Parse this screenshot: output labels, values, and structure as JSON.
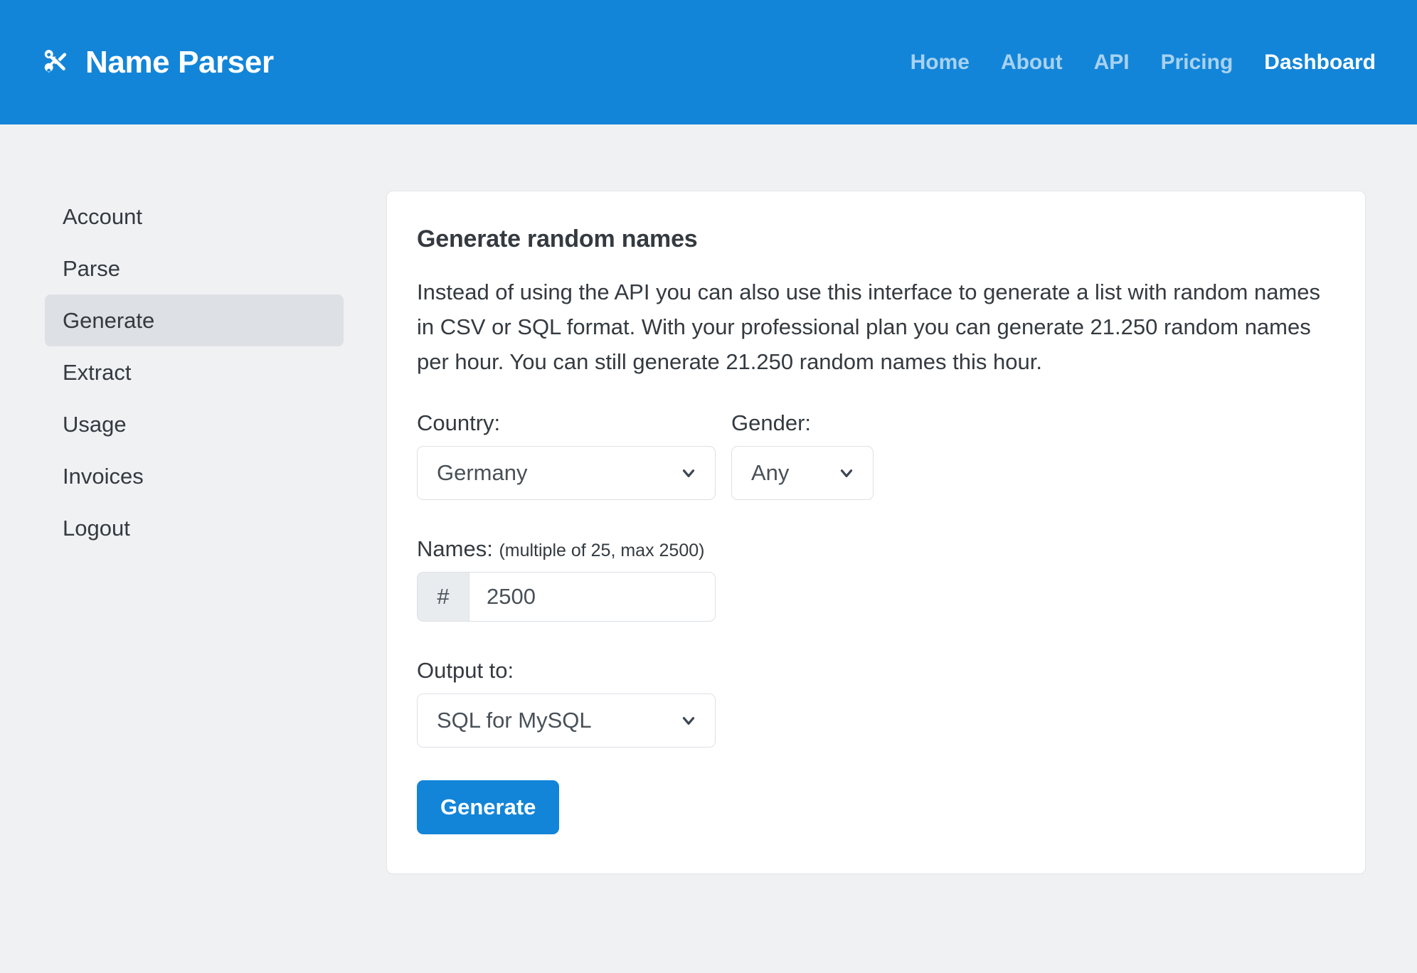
{
  "header": {
    "brand_icon": "scissors-icon",
    "brand_name": "Name Parser",
    "nav": [
      {
        "label": "Home",
        "active": false
      },
      {
        "label": "About",
        "active": false
      },
      {
        "label": "API",
        "active": false
      },
      {
        "label": "Pricing",
        "active": false
      },
      {
        "label": "Dashboard",
        "active": true
      }
    ],
    "background_color": "#1385d8"
  },
  "sidebar": {
    "items": [
      {
        "label": "Account",
        "active": false
      },
      {
        "label": "Parse",
        "active": false
      },
      {
        "label": "Generate",
        "active": true
      },
      {
        "label": "Extract",
        "active": false
      },
      {
        "label": "Usage",
        "active": false
      },
      {
        "label": "Invoices",
        "active": false
      },
      {
        "label": "Logout",
        "active": false
      }
    ],
    "active_background_color": "#dde0e4"
  },
  "main": {
    "card": {
      "title": "Generate random names",
      "description": "Instead of using the API you can also use this interface to generate a list with random names in CSV or SQL format. With your professional plan you can generate 21.250 random names per hour. You can still generate 21.250 random names this hour.",
      "form": {
        "country": {
          "label": "Country:",
          "value": "Germany",
          "options": [
            "Germany"
          ],
          "chevron": "chevron-down-icon"
        },
        "gender": {
          "label": "Gender:",
          "value": "Any",
          "options": [
            "Any"
          ],
          "chevron": "chevron-down-icon"
        },
        "names": {
          "label": "Names:",
          "hint": "(multiple of 25, max 2500)",
          "prefix": "#",
          "value": "2500",
          "placeholder": "2500"
        },
        "output": {
          "label": "Output to:",
          "value": "SQL for MySQL",
          "options": [
            "SQL for MySQL"
          ],
          "chevron": "chevron-down-icon"
        },
        "submit_label": "Generate",
        "submit_color": "#1385d8"
      }
    }
  },
  "page": {
    "background_color": "#f0f1f3",
    "card_background_color": "#ffffff",
    "text_color": "#343a40"
  }
}
